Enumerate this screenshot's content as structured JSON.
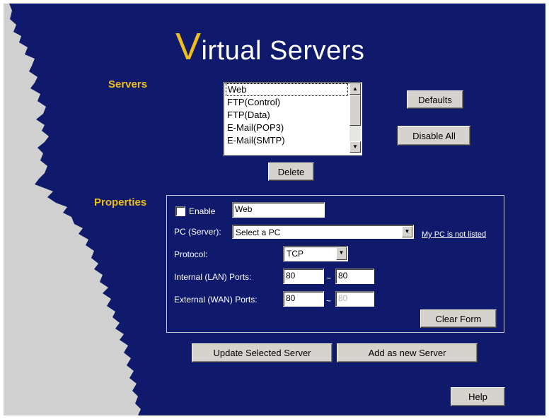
{
  "title": {
    "first": "V",
    "rest": "irtual Servers"
  },
  "servers": {
    "heading": "Servers",
    "list": [
      "Web",
      "FTP(Control)",
      "FTP(Data)",
      "E-Mail(POP3)",
      "E-Mail(SMTP)"
    ],
    "selected": "Web",
    "defaults_label": "Defaults",
    "disable_all_label": "Disable All",
    "delete_label": "Delete"
  },
  "properties": {
    "heading": "Properties",
    "enable_label": "Enable",
    "enable_checked": false,
    "name_value": "Web",
    "pc_label": "PC (Server):",
    "pc_value": "Select a PC",
    "pc_link": "My PC is not listed",
    "protocol_label": "Protocol:",
    "protocol_value": "TCP",
    "internal_label": "Internal (LAN) Ports:",
    "internal_from": "80",
    "internal_to": "80",
    "external_label": "External (WAN) Ports:",
    "external_from": "80",
    "external_to": "80",
    "tilde": "~",
    "clear_label": "Clear Form"
  },
  "actions": {
    "update_label": "Update Selected Server",
    "add_label": "Add as new Server",
    "help_label": "Help"
  },
  "colors": {
    "panel": "#0f1a6c",
    "accent": "#f0be1c",
    "edge": "#d0d0d0"
  },
  "icons": {
    "scroll_up": "triangle-up",
    "scroll_down": "triangle-down",
    "dropdown": "triangle-down"
  }
}
